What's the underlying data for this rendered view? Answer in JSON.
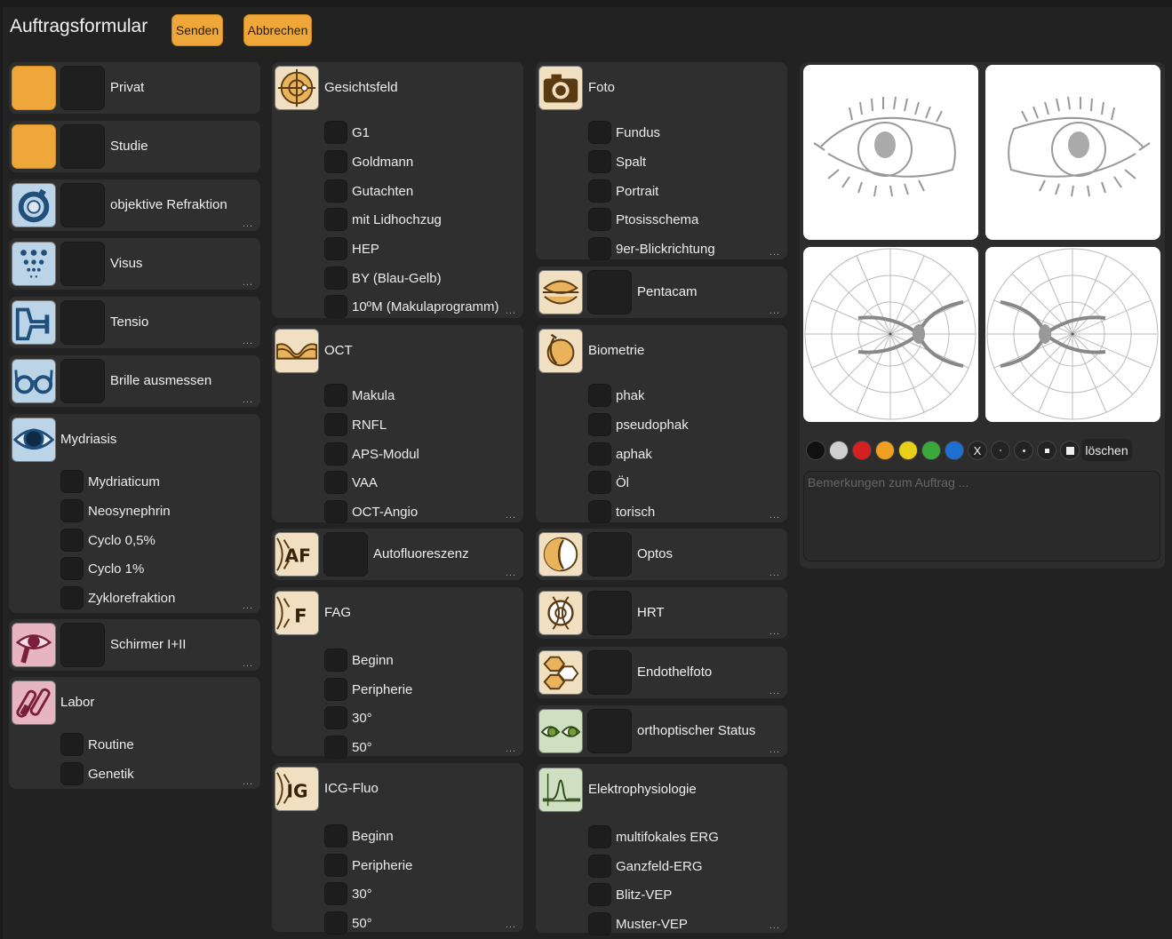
{
  "header": {
    "title": "Auftragsformular",
    "send_label": "Senden",
    "cancel_label": "Abbrechen"
  },
  "dots": "...",
  "col1": {
    "privat": "Privat",
    "studie": "Studie",
    "objektive_refraktion": "objektive Refraktion",
    "visus": "Visus",
    "tensio": "Tensio",
    "brille": "Brille ausmessen",
    "mydriasis": {
      "title": "Mydriasis",
      "options": [
        "Mydriaticum",
        "Neosynephrin",
        "Cyclo 0,5%",
        "Cyclo 1%",
        "Zyklorefraktion"
      ]
    },
    "schirmer": "Schirmer I+II",
    "labor": {
      "title": "Labor",
      "options": [
        "Routine",
        "Genetik"
      ]
    }
  },
  "col2": {
    "gesichtsfeld": {
      "title": "Gesichtsfeld",
      "options": [
        "G1",
        "Goldmann",
        "Gutachten",
        "mit Lidhochzug",
        "HEP",
        "BY (Blau-Gelb)",
        "10ºM (Makulaprogramm)"
      ]
    },
    "oct": {
      "title": "OCT",
      "options": [
        "Makula",
        "RNFL",
        "APS-Modul",
        "VAA",
        "OCT-Angio"
      ]
    },
    "autofluoreszenz": "Autofluoreszenz",
    "fag": {
      "title": "FAG",
      "options": [
        "Beginn",
        "Peripherie",
        "30°",
        "50°"
      ]
    },
    "icg": {
      "title": "ICG-Fluo",
      "options": [
        "Beginn",
        "Peripherie",
        "30°",
        "50°"
      ]
    }
  },
  "col3": {
    "foto": {
      "title": "Foto",
      "options": [
        "Fundus",
        "Spalt",
        "Portrait",
        "Ptosisschema",
        "9er-Blickrichtung"
      ]
    },
    "pentacam": "Pentacam",
    "biometrie": {
      "title": "Biometrie",
      "options": [
        "phak",
        "pseudophak",
        "aphak",
        "Öl",
        "torisch"
      ]
    },
    "optos": "Optos",
    "hrt": "HRT",
    "endothelfoto": "Endothelfoto",
    "orthoptisch": "orthoptischer Status",
    "elektro": {
      "title": "Elektrophysiologie",
      "options": [
        "multifokales ERG",
        "Ganzfeld-ERG",
        "Blitz-VEP",
        "Muster-VEP"
      ]
    }
  },
  "drawing": {
    "colors": [
      "#111111",
      "#cfcfcf",
      "#d42020",
      "#f0a020",
      "#e8d018",
      "#3aa83a",
      "#1f6fd0"
    ],
    "eraser_label": "X",
    "clear_label": "löschen"
  },
  "remarks_placeholder": "Bemerkungen zum Auftrag ...",
  "icon_text": {
    "af": "AF",
    "f": "F",
    "ig": "IG"
  }
}
